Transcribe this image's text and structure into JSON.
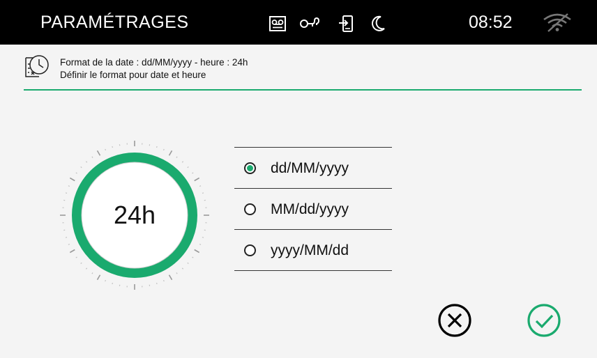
{
  "app": {
    "title": "PARAMÉTRAGES",
    "time": "08:52",
    "status_icons": [
      "voicemail-icon",
      "key-icon",
      "phone-transfer-icon",
      "moon-icon"
    ],
    "wifi_icon": "wifi-off-icon"
  },
  "header": {
    "icon": "date-time-settings-icon",
    "line1": "Format de la date : dd/MM/yyyy - heure : 24h",
    "line2": "Définir le format pour date et heure"
  },
  "dial": {
    "value": "24h"
  },
  "date_formats": {
    "selected": "dd/MM/yyyy",
    "options": [
      {
        "label": "dd/MM/yyyy",
        "checked": true
      },
      {
        "label": "MM/dd/yyyy",
        "checked": false
      },
      {
        "label": "yyyy/MM/dd",
        "checked": false
      }
    ]
  },
  "actions": {
    "cancel_icon": "cancel-circle-x-icon",
    "confirm_icon": "confirm-circle-check-icon"
  },
  "colors": {
    "accent": "#1aaa6e",
    "topbar": "#000000",
    "background": "#f4f4f4"
  }
}
